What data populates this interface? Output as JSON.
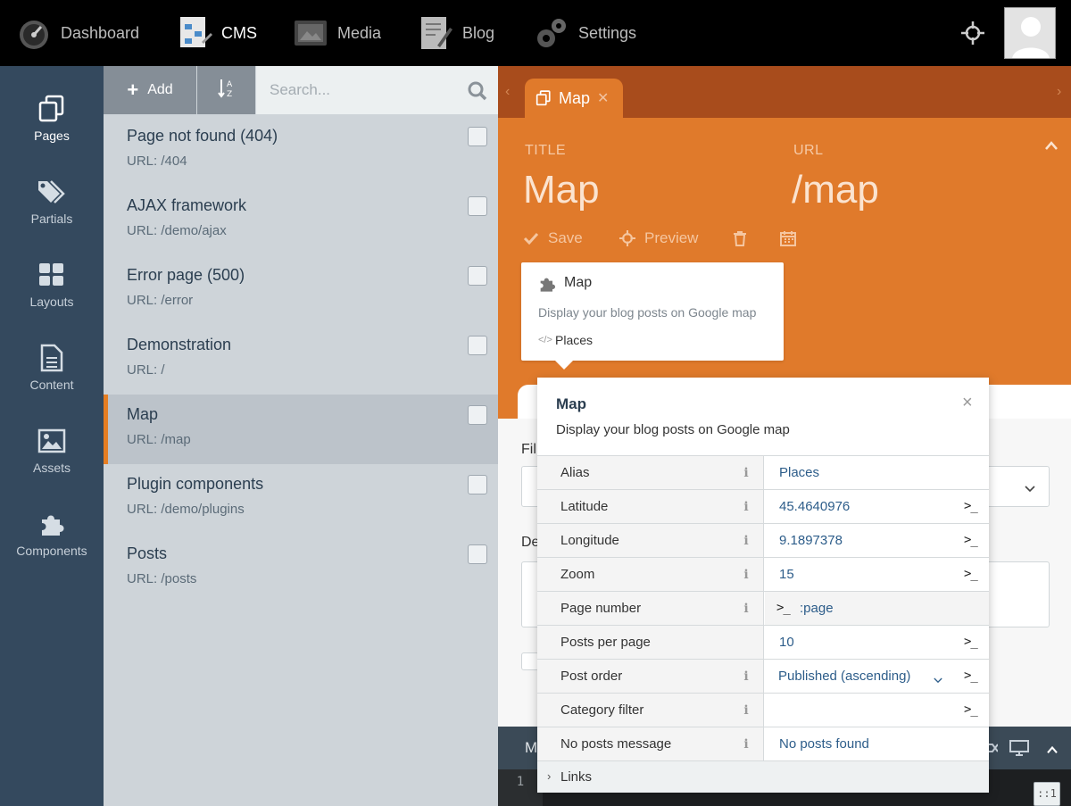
{
  "topnav": {
    "items": [
      {
        "label": "Dashboard",
        "icon": "dashboard-gauge-icon"
      },
      {
        "label": "CMS",
        "icon": "cms-icon"
      },
      {
        "label": "Media",
        "icon": "media-icon"
      },
      {
        "label": "Blog",
        "icon": "blog-icon"
      },
      {
        "label": "Settings",
        "icon": "settings-gears-icon"
      }
    ],
    "active": "CMS"
  },
  "sidebar": {
    "items": [
      {
        "label": "Pages",
        "icon": "pages-icon"
      },
      {
        "label": "Partials",
        "icon": "partials-tag-icon"
      },
      {
        "label": "Layouts",
        "icon": "layouts-grid-icon"
      },
      {
        "label": "Content",
        "icon": "content-file-icon"
      },
      {
        "label": "Assets",
        "icon": "assets-image-icon"
      },
      {
        "label": "Components",
        "icon": "components-puzzle-icon"
      }
    ],
    "active": "Pages"
  },
  "list": {
    "add_label": "Add",
    "search_placeholder": "Search...",
    "pages": [
      {
        "title": "Page not found (404)",
        "url": "URL: /404"
      },
      {
        "title": "AJAX framework",
        "url": "URL: /demo/ajax"
      },
      {
        "title": "Error page (500)",
        "url": "URL: /error"
      },
      {
        "title": "Demonstration",
        "url": "URL: /"
      },
      {
        "title": "Map",
        "url": "URL: /map"
      },
      {
        "title": "Plugin components",
        "url": "URL: /demo/plugins"
      },
      {
        "title": "Posts",
        "url": "URL: /posts"
      }
    ],
    "selected": "Map"
  },
  "editor": {
    "tab_label": "Map",
    "title_label": "TITLE",
    "title_value": "Map",
    "url_label": "URL",
    "url_value": "/map",
    "toolbar": {
      "save": "Save",
      "preview": "Preview"
    },
    "component_card": {
      "title": "Map",
      "description": "Display your blog posts on Google map",
      "alias": "Places"
    },
    "form": {
      "label_1": "Fil",
      "label_2": "De"
    },
    "code_bar_label": "M",
    "line_number": "1",
    "cursor_badge": "::1",
    "colors": {
      "accent": "#e07a2b",
      "tabstrip": "#a84c1c",
      "sidebar": "#34495e"
    }
  },
  "inspector": {
    "title": "Map",
    "description": "Display your blog posts on Google map",
    "rows": [
      {
        "name": "Alias",
        "value": "Places"
      },
      {
        "name": "Latitude",
        "value": "45.4640976"
      },
      {
        "name": "Longitude",
        "value": "9.1897378"
      },
      {
        "name": "Zoom",
        "value": "15"
      },
      {
        "name": "Page number",
        "value": ":page"
      },
      {
        "name": "Posts per page",
        "value": "10"
      },
      {
        "name": "Post order",
        "value": "Published (ascending)"
      },
      {
        "name": "Category filter",
        "value": ""
      },
      {
        "name": "No posts message",
        "value": "No posts found"
      }
    ],
    "links_label": "Links"
  }
}
